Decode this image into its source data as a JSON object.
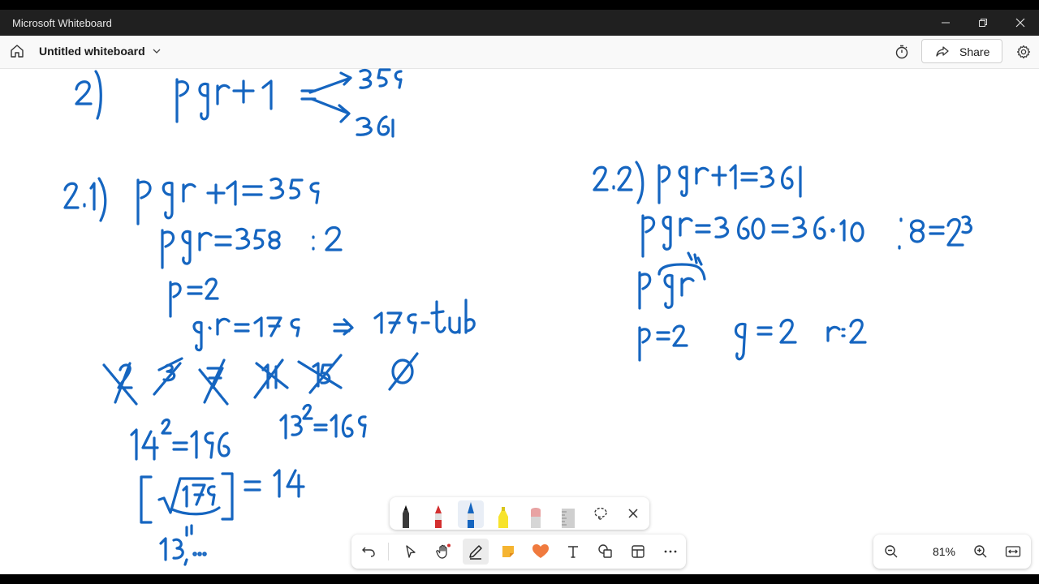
{
  "window": {
    "app_title": "Microsoft Whiteboard"
  },
  "header": {
    "board_title": "Untitled whiteboard",
    "share_label": "Share"
  },
  "zoom": {
    "level": "81%"
  },
  "colors": {
    "ink": "#1565c0",
    "titlebar": "#202020",
    "canvas": "#ffffff"
  },
  "pens": [
    {
      "name": "black-pen",
      "color": "#222222"
    },
    {
      "name": "red-pen",
      "color": "#d32f2f"
    },
    {
      "name": "blue-pen",
      "color": "#1565c0",
      "selected": true
    },
    {
      "name": "yellow-highlighter",
      "color": "#f7e32c"
    },
    {
      "name": "eraser",
      "color": "#e8a3a3"
    },
    {
      "name": "ruler",
      "color": "#bbbbbb"
    }
  ],
  "tools": [
    "undo-icon",
    "select-icon",
    "hand-icon",
    "pen-icon",
    "sticky-note-icon",
    "reaction-icon",
    "text-icon",
    "shapes-icon",
    "templates-icon",
    "more-icon"
  ]
}
